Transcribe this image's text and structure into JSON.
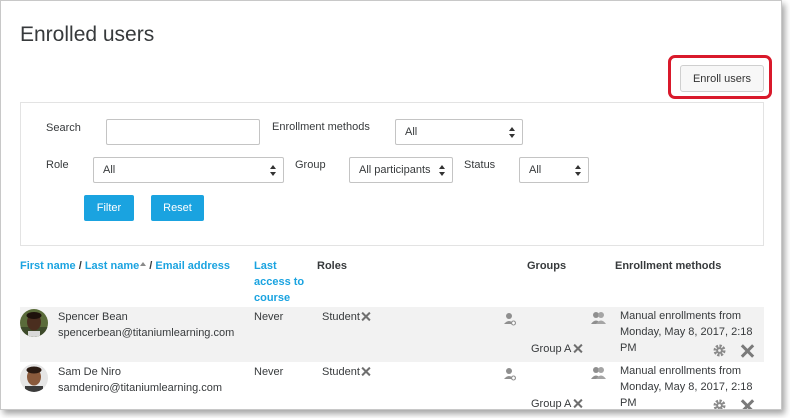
{
  "page": {
    "title": "Enrolled users"
  },
  "toolbar": {
    "enroll_label": "Enroll users"
  },
  "filter": {
    "search_label": "Search",
    "search_value": "",
    "enrollment_methods_label": "Enrollment methods",
    "enrollment_methods_value": "All",
    "role_label": "Role",
    "role_value": "All",
    "group_label": "Group",
    "group_value": "All participants",
    "status_label": "Status",
    "status_value": "All",
    "filter_button": "Filter",
    "reset_button": "Reset"
  },
  "table": {
    "headers": {
      "first_name": "First name",
      "sep1": " / ",
      "last_name": "Last name",
      "sep2": " / ",
      "email": "Email address",
      "last_access": "Last access to course",
      "roles": "Roles",
      "groups": "Groups",
      "enrollment_methods": "Enrollment methods"
    },
    "rows": [
      {
        "name": "Spencer Bean",
        "email": "spencerbean@titaniumlearning.com",
        "last_access": "Never",
        "role": "Student",
        "group": "Group A",
        "enrollment": "Manual enrollments from Monday, May 8, 2017, 2:18 PM"
      },
      {
        "name": "Sam De Niro",
        "email": "samdeniro@titaniumlearning.com",
        "last_access": "Never",
        "role": "Student",
        "group": "Group A",
        "enrollment": "Manual enrollments from Monday, May 8, 2017, 2:18 PM"
      }
    ]
  },
  "colors": {
    "accent": "#1aa3e0",
    "highlight": "#d9192b",
    "row_shade": "#f2f2f2"
  }
}
